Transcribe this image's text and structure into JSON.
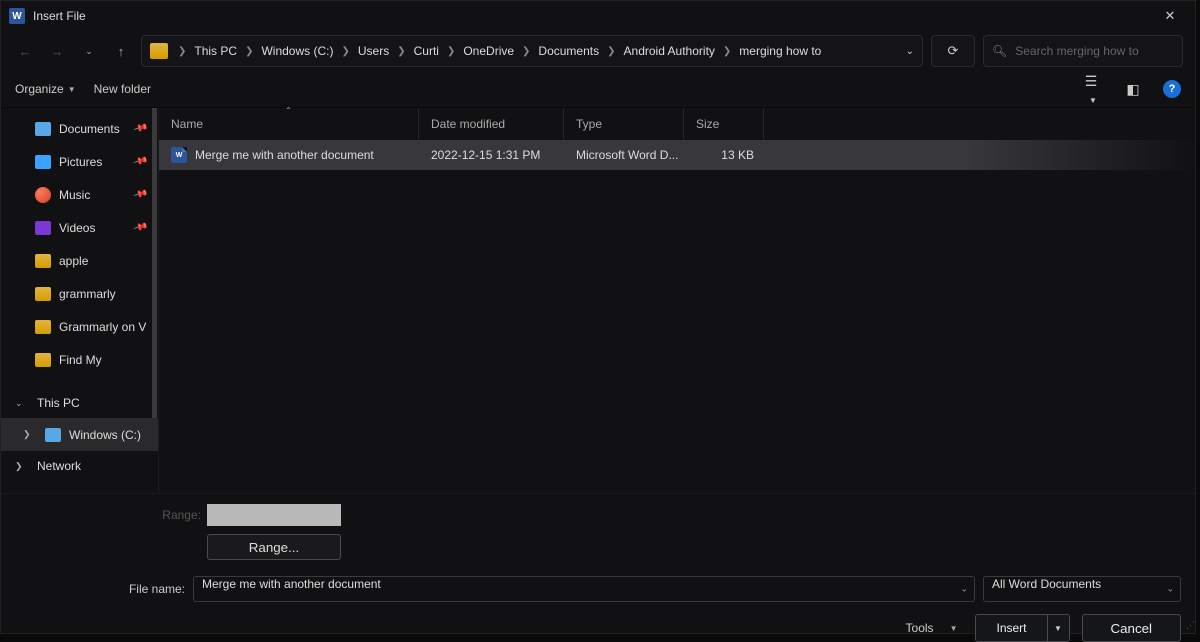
{
  "title": "Insert File",
  "breadcrumb": [
    "This PC",
    "Windows (C:)",
    "Users",
    "Curti",
    "OneDrive",
    "Documents",
    "Android Authority",
    "merging how to"
  ],
  "search_placeholder": "Search merging how to",
  "toolbar": {
    "organize": "Organize",
    "newfolder": "New folder"
  },
  "sidebar": {
    "quick": [
      {
        "label": "Documents",
        "icon": "doc",
        "pinned": true
      },
      {
        "label": "Pictures",
        "icon": "pic",
        "pinned": true
      },
      {
        "label": "Music",
        "icon": "music",
        "pinned": true
      },
      {
        "label": "Videos",
        "icon": "video",
        "pinned": true
      },
      {
        "label": "apple",
        "icon": "folder"
      },
      {
        "label": "grammarly",
        "icon": "folder"
      },
      {
        "label": "Grammarly on V",
        "icon": "folder"
      },
      {
        "label": "Find My",
        "icon": "folder"
      }
    ],
    "thispc_label": "This PC",
    "drive_label": "Windows (C:)",
    "network_label": "Network"
  },
  "columns": {
    "name": "Name",
    "date": "Date modified",
    "type": "Type",
    "size": "Size"
  },
  "files": [
    {
      "name": "Merge me with another document",
      "date": "2022-12-15 1:31 PM",
      "type": "Microsoft Word D...",
      "size": "13 KB"
    }
  ],
  "range_label": "Range:",
  "range_button": "Range...",
  "filename_label": "File name:",
  "filename_value": "Merge me with another document",
  "filetype_value": "All Word Documents",
  "tools_label": "Tools",
  "insert_label": "Insert",
  "cancel_label": "Cancel"
}
